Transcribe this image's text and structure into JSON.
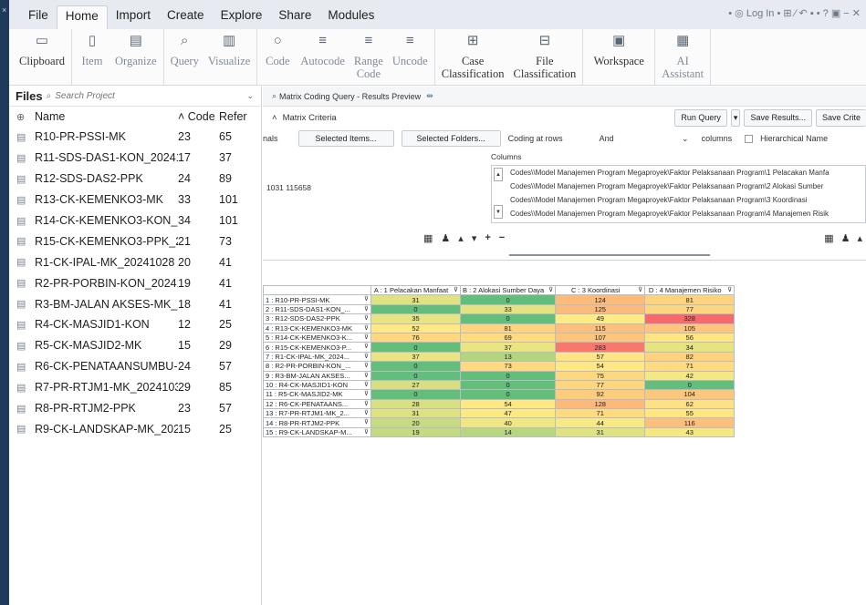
{
  "tabs": [
    "File",
    "Home",
    "Import",
    "Create",
    "Explore",
    "Share",
    "Modules"
  ],
  "active_tab": "Home",
  "top_right": "• ◎ Log In • ⊞ ⁄ ↶ ▪ • ? ▣ − ✕",
  "ribbon": {
    "clipboard": "Clipboard",
    "item": "Item",
    "organize": "Organize",
    "query": "Query",
    "visualize": "Visualize",
    "code": "Code",
    "autocode": "Autocode",
    "range_code": "Range Code",
    "range_l1": "Range",
    "range_l2": "Code",
    "uncode": "Uncode",
    "case_l1": "Case",
    "case_l2": "Classification",
    "file_l1": "File",
    "file_l2": "Classification",
    "workspace": "Workspace",
    "ai_l1": "AI",
    "ai_l2": "Assistant"
  },
  "files": {
    "title": "Files",
    "search_placeholder": "Search Project",
    "col_name": "Name",
    "col_code": "Code",
    "col_refer": "Refer",
    "rows": [
      {
        "name": "R10-PR-PSSI-MK",
        "code": "23",
        "refer": "65"
      },
      {
        "name": "R11-SDS-DAS1-KON_2024103",
        "code": "17",
        "refer": "37"
      },
      {
        "name": "R12-SDS-DAS2-PPK",
        "code": "24",
        "refer": "89"
      },
      {
        "name": "R13-CK-KEMENKO3-MK",
        "code": "33",
        "refer": "101"
      },
      {
        "name": "R14-CK-KEMENKO3-KON_202",
        "code": "34",
        "refer": "101"
      },
      {
        "name": "R15-CK-KEMENKO3-PPK_2024",
        "code": "21",
        "refer": "73"
      },
      {
        "name": "R1-CK-IPAL-MK_20241028 16",
        "code": "20",
        "refer": "41"
      },
      {
        "name": "R2-PR-PORBIN-KON_2024102",
        "code": "19",
        "refer": "41"
      },
      {
        "name": "R3-BM-JALAN AKSES-MK_202",
        "code": "18",
        "refer": "41"
      },
      {
        "name": "R4-CK-MASJID1-KON",
        "code": "12",
        "refer": "25"
      },
      {
        "name": "R5-CK-MASJID2-MK",
        "code": "15",
        "refer": "29"
      },
      {
        "name": "R6-CK-PENATAANSUMBU-PP",
        "code": "24",
        "refer": "57"
      },
      {
        "name": "R7-PR-RTJM1-MK_20241031",
        "code": "29",
        "refer": "85"
      },
      {
        "name": "R8-PR-RTJM2-PPK",
        "code": "23",
        "refer": "57"
      },
      {
        "name": "R9-CK-LANDSKAP-MK_20241",
        "code": "15",
        "refer": "25"
      }
    ]
  },
  "pane": {
    "tab_title": "Matrix Coding Query - Results Preview",
    "criteria": "Matrix Criteria",
    "run_query": "Run Query",
    "save_results": "Save Results...",
    "save_criteria": "Save Crite",
    "nals": "nals",
    "selected_items": "Selected Items...",
    "selected_folders": "Selected Folders...",
    "coding_at_rows": "Coding at rows",
    "and": "And",
    "columns_small": "columns",
    "hierarchical_name": "Hierarchical Name",
    "columns_header": "Columns",
    "left_value": "1031 115658",
    "codes": [
      "Codes\\\\Model Manajemen Program Megaproyek\\Faktor Pelaksanaan Program\\1 Pelacakan Manfa",
      "Codes\\\\Model Manajemen Program Megaproyek\\Faktor Pelaksanaan Program\\2 Alokasi Sumber",
      "Codes\\\\Model Manajemen Program Megaproyek\\Faktor Pelaksanaan Program\\3 Koordinasi",
      "Codes\\\\Model Manajemen Program Megaproyek\\Faktor Pelaksanaan Program\\4 Manajemen Risik"
    ]
  },
  "matrix": {
    "columns": [
      "A : 1 Pelacakan Manfaat",
      "B : 2 Alokasi Sumber Daya",
      "C : 3 Koordinasi",
      "D : 4 Manajemen Risiko"
    ],
    "rows": [
      {
        "label": "1 : R10-PR-PSSI-MK",
        "values": [
          31,
          0,
          124,
          81
        ]
      },
      {
        "label": "2 : R11-SDS-DAS1-KON_...",
        "values": [
          0,
          33,
          125,
          77
        ]
      },
      {
        "label": "3 : R12-SDS-DAS2-PPK",
        "values": [
          35,
          0,
          49,
          328
        ]
      },
      {
        "label": "4 : R13-CK-KEMENKO3-MK",
        "values": [
          52,
          81,
          115,
          105
        ]
      },
      {
        "label": "5 : R14-CK-KEMENKO3-K...",
        "values": [
          76,
          69,
          107,
          56
        ]
      },
      {
        "label": "6 : R15-CK-KEMENKO3-P...",
        "values": [
          0,
          37,
          283,
          34
        ]
      },
      {
        "label": "7 : R1-CK-IPAL-MK_2024...",
        "values": [
          37,
          13,
          57,
          82
        ]
      },
      {
        "label": "8 : R2-PR-PORBIN-KON_...",
        "values": [
          0,
          73,
          54,
          71
        ]
      },
      {
        "label": "9 : R3-BM-JALAN AKSES...",
        "values": [
          0,
          0,
          75,
          42
        ]
      },
      {
        "label": "10 : R4-CK-MASJID1-KON",
        "values": [
          27,
          0,
          77,
          0
        ]
      },
      {
        "label": "11 : R5-CK-MASJID2-MK",
        "values": [
          0,
          0,
          92,
          104
        ]
      },
      {
        "label": "12 : R6-CK-PENATAANS...",
        "values": [
          28,
          54,
          128,
          62
        ]
      },
      {
        "label": "13 : R7-PR-RTJM1-MK_2...",
        "values": [
          31,
          47,
          71,
          55
        ]
      },
      {
        "label": "14 : R8-PR-RTJM2-PPK",
        "values": [
          20,
          40,
          44,
          116
        ]
      },
      {
        "label": "15 : R9-CK-LANDSKAP-M...",
        "values": [
          19,
          14,
          31,
          43
        ]
      }
    ],
    "colors": {
      "low": "#63be7b",
      "mid": "#ffeb84",
      "high": "#f8696b"
    }
  }
}
